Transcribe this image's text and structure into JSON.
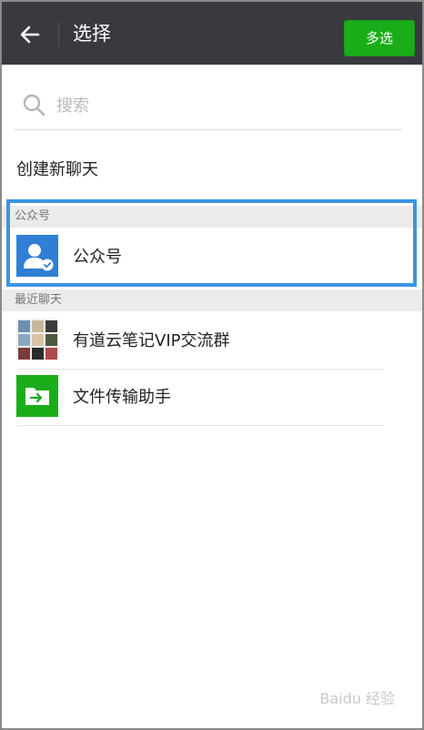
{
  "header": {
    "title": "选择",
    "multi_select_label": "多选"
  },
  "search": {
    "placeholder": "搜索"
  },
  "new_chat_label": "创建新聊天",
  "sections": {
    "official": "公众号",
    "recent": "最近聊天"
  },
  "official_item": {
    "label": "公众号"
  },
  "recent_items": [
    {
      "label": "有道云笔记VIP交流群"
    },
    {
      "label": "文件传输助手"
    }
  ],
  "watermark": "Baidu 经验",
  "colors": {
    "topbar": "#393a3f",
    "accent_green": "#1aad19",
    "highlight_blue": "#3a95e3"
  }
}
